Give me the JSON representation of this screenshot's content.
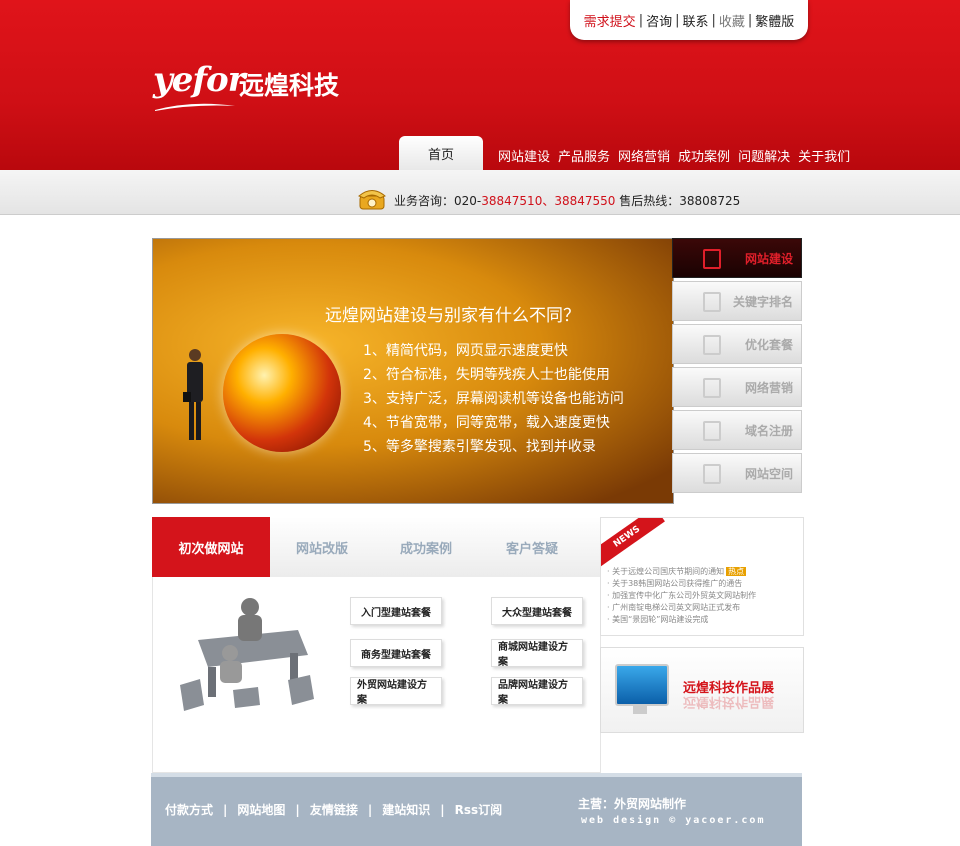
{
  "topbar": {
    "items": [
      {
        "label": "需求提交",
        "style": "red"
      },
      {
        "label": "咨询",
        "style": "normal"
      },
      {
        "label": "联系",
        "style": "normal"
      },
      {
        "label": "收藏",
        "style": "grey"
      },
      {
        "label": "繁體版",
        "style": "normal"
      }
    ]
  },
  "logo": {
    "latin": "yefor",
    "cn": "远煌科技"
  },
  "nav": {
    "home": "首页",
    "items": [
      "网站建设",
      "产品服务",
      "网络营销",
      "成功案例",
      "问题解决",
      "关于我们"
    ]
  },
  "info": {
    "prefix": "业务咨询：020-",
    "phone1": "38847510",
    "sep": "、",
    "phone2": "38847550",
    "hotline": " 售后热线：38808725"
  },
  "banner": {
    "title": "远煌网站建设与别家有什么不同？",
    "points": [
      "1、精简代码，网页显示速度更快",
      "2、符合标准，失明等残疾人士也能使用",
      "3、支持广泛，屏幕阅读机等设备也能访问",
      "4、节省宽带，同等宽带，载入速度更快",
      "5、等多擎搜素引擎发现、找到并收录"
    ]
  },
  "side_menu": [
    "网站建设",
    "关键字排名",
    "优化套餐",
    "网络营销",
    "域名注册",
    "网站空间"
  ],
  "tabs": [
    "初次做网站",
    "网站改版",
    "成功案例",
    "客户答疑"
  ],
  "packages": [
    "入门型建站套餐",
    "大众型建站套餐",
    "商务型建站套餐",
    "商城网站建设方案",
    "外贸网站建设方案",
    "品牌网站建设方案"
  ],
  "news": {
    "tag": "NEWS",
    "hot_label": "热点",
    "items": [
      "· 关于远煌公司国庆节期间的通知",
      "· 关于38韩国网站公司获得推广的通告",
      "· 加强宣传中化广东公司外贸英文网站制作",
      "· 广州南锭电梯公司英文网站正式发布",
      "· 美国“景园轮”网站建设完成"
    ]
  },
  "showcase": {
    "title": "远煌科技作品展"
  },
  "footer": {
    "links": [
      "付款方式",
      "网站地图",
      "友情链接",
      "建站知识",
      "Rss订阅"
    ],
    "main": "主营：外贸网站制作",
    "web": "web design © yacoer.com"
  },
  "colors": {
    "brand_red": "#d4141b",
    "footer_blue": "#a7b5c4"
  }
}
